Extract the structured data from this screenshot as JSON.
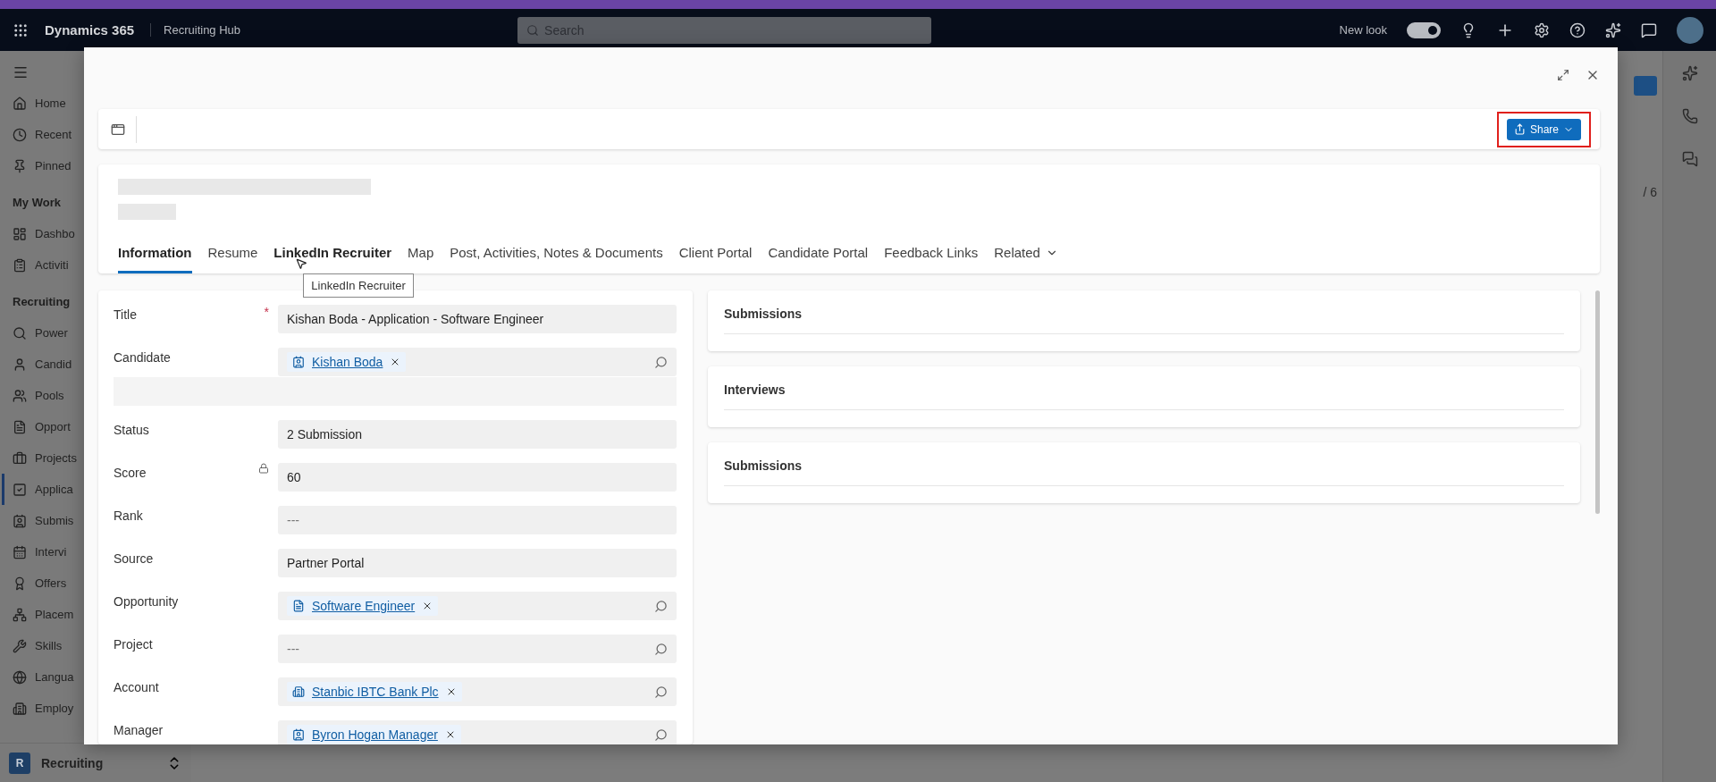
{
  "top_bar": {
    "app_name": "Dynamics 365",
    "area_name": "Recruiting Hub",
    "search": {
      "placeholder": "Search"
    },
    "new_look": {
      "label": "New look",
      "on": true
    }
  },
  "sidebar": {
    "groups": [
      {
        "items": [
          {
            "label": "Home",
            "selected": false
          },
          {
            "label": "Recent",
            "selected": false
          },
          {
            "label": "Pinned",
            "selected": false
          }
        ]
      },
      {
        "title": "My Work",
        "items": [
          {
            "label": "Dashbo",
            "selected": false
          },
          {
            "label": "Activiti",
            "selected": false
          }
        ]
      },
      {
        "title": "Recruiting",
        "items": [
          {
            "label": "Power",
            "selected": false
          },
          {
            "label": "Candid",
            "selected": false
          },
          {
            "label": "Pools",
            "selected": false
          },
          {
            "label": "Opport",
            "selected": false
          },
          {
            "label": "Projects",
            "selected": false
          },
          {
            "label": "Applica",
            "selected": true
          },
          {
            "label": "Submis",
            "selected": false
          },
          {
            "label": "Intervi",
            "selected": false
          },
          {
            "label": "Offers",
            "selected": false
          },
          {
            "label": "Placem",
            "selected": false
          },
          {
            "label": "Skills",
            "selected": false
          },
          {
            "label": "Langua",
            "selected": false
          },
          {
            "label": "Employ",
            "selected": false
          }
        ]
      }
    ]
  },
  "area_switcher": {
    "badge": "R",
    "label": "Recruiting"
  },
  "background": {
    "page_counter": "/ 6"
  },
  "modal": {
    "command_bar": {
      "share_button": {
        "label": "Share",
        "highlighted": true
      }
    },
    "record_header": {
      "tabs": [
        {
          "label": "Information",
          "selected": true,
          "hovered": false
        },
        {
          "label": "Resume",
          "selected": false,
          "hovered": false
        },
        {
          "label": "LinkedIn Recruiter",
          "selected": false,
          "hovered": true
        },
        {
          "label": "Map",
          "selected": false,
          "hovered": false
        },
        {
          "label": "Post, Activities, Notes & Documents",
          "selected": false,
          "hovered": false
        },
        {
          "label": "Client Portal",
          "selected": false,
          "hovered": false
        },
        {
          "label": "Candidate Portal",
          "selected": false,
          "hovered": false
        },
        {
          "label": "Feedback Links",
          "selected": false,
          "hovered": false
        },
        {
          "label": "Related",
          "selected": false,
          "hovered": false,
          "dropdown": true
        }
      ],
      "tooltip": "LinkedIn Recruiter"
    },
    "form": {
      "fields": [
        {
          "kind": "text",
          "label": "Title",
          "required_mark": "*",
          "value": "Kishan Boda - Application - Software Engineer"
        },
        {
          "kind": "lookup",
          "label": "Candidate",
          "chip": {
            "label": "Kishan Boda",
            "kind": "contact"
          }
        },
        {
          "kind": "blank"
        },
        {
          "kind": "text",
          "label": "Status",
          "value": "2 Submission"
        },
        {
          "kind": "text",
          "label": "Score",
          "locked": true,
          "value": "60"
        },
        {
          "kind": "text",
          "label": "Rank",
          "placeholder": "---"
        },
        {
          "kind": "text",
          "label": "Source",
          "value": "Partner Portal"
        },
        {
          "kind": "lookup",
          "label": "Opportunity",
          "chip": {
            "label": "Software Engineer",
            "kind": "opportunity"
          }
        },
        {
          "kind": "lookup",
          "label": "Project",
          "placeholder": "---"
        },
        {
          "kind": "lookup",
          "label": "Account",
          "chip": {
            "label": "Stanbic IBTC Bank Plc",
            "kind": "account"
          }
        },
        {
          "kind": "lookup",
          "label": "Manager",
          "chip": {
            "label": "Byron Hogan Manager",
            "kind": "contact"
          }
        }
      ]
    },
    "sections": [
      {
        "title": "Submissions"
      },
      {
        "title": "Interviews"
      },
      {
        "title": "Submissions"
      }
    ]
  }
}
